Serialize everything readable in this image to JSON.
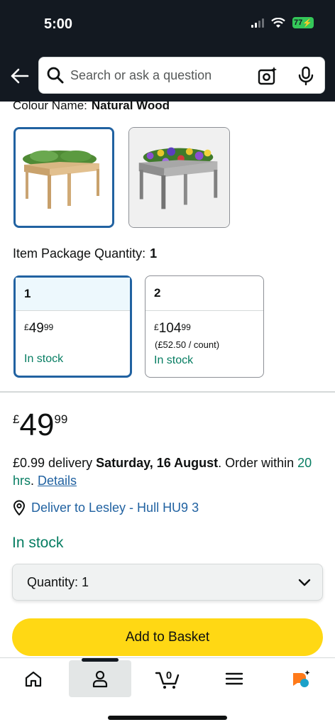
{
  "status_bar": {
    "time": "5:00",
    "battery": "77"
  },
  "search": {
    "placeholder": "Search or ask a question"
  },
  "colour": {
    "label": "Colour Name:",
    "value": "Natural Wood"
  },
  "package": {
    "label": "Item Package Quantity:",
    "value": "1"
  },
  "quantity_options": [
    {
      "qty": "1",
      "currency": "£",
      "whole": "49",
      "fraction": "99",
      "unit_price": "",
      "stock": "In stock",
      "selected": true
    },
    {
      "qty": "2",
      "currency": "£",
      "whole": "104",
      "fraction": "99",
      "unit_price": "(£52.50 / count)",
      "stock": "In stock",
      "selected": false
    }
  ],
  "price": {
    "currency": "£",
    "whole": "49",
    "fraction": "99"
  },
  "delivery": {
    "prefix": "£0.99 delivery ",
    "date": "Saturday, 16 August",
    "middle": ". Order within ",
    "time": "20 hrs",
    "sep": ". ",
    "details_link": "Details"
  },
  "deliver_to": "Deliver to Lesley - Hull HU9 3",
  "stock_status": "In stock",
  "quantity_select": "Quantity: 1",
  "add_to_basket": "Add to Basket",
  "cart_count": "0",
  "colors": {
    "accent_blue": "#2162a1",
    "stock_green": "#067d62",
    "button_yellow": "#ffd814",
    "header_dark": "#131921"
  }
}
